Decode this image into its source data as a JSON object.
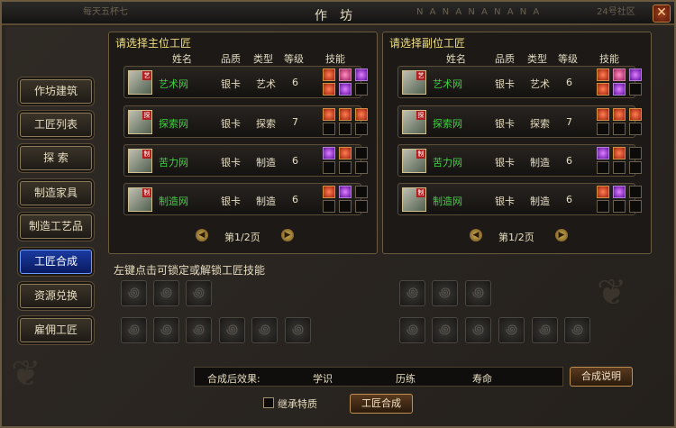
{
  "window": {
    "title": "作坊",
    "bg_left": "每天五杯七",
    "bg_right": "N A N A N A N A N A",
    "bg_far": "24号社区",
    "close_label": "✕"
  },
  "nav": [
    {
      "label": "作坊建筑",
      "active": false
    },
    {
      "label": "工匠列表",
      "active": false
    },
    {
      "label": "探 索",
      "active": false
    },
    {
      "label": "制造家具",
      "active": false
    },
    {
      "label": "制造工艺品",
      "active": false
    },
    {
      "label": "工匠合成",
      "active": true
    },
    {
      "label": "资源兑换",
      "active": false
    },
    {
      "label": "雇佣工匠",
      "active": false
    }
  ],
  "columns": {
    "name": "姓名",
    "quality": "品质",
    "type": "类型",
    "level": "等级",
    "skills": "技能"
  },
  "main_panel": {
    "title": "请选择主位工匠",
    "rows": [
      {
        "tag": "艺",
        "name": "艺术网",
        "quality": "银卡",
        "type": "艺术",
        "level": "6",
        "skills": [
          "red",
          "pink",
          "purple",
          "red",
          "purple",
          "empty"
        ]
      },
      {
        "tag": "探",
        "name": "探索网",
        "quality": "银卡",
        "type": "探索",
        "level": "7",
        "skills": [
          "red",
          "red",
          "red",
          "empty",
          "empty",
          "empty"
        ]
      },
      {
        "tag": "制",
        "name": "苦力网",
        "quality": "银卡",
        "type": "制造",
        "level": "6",
        "skills": [
          "purple",
          "red",
          "empty",
          "empty",
          "empty",
          "empty"
        ]
      },
      {
        "tag": "制",
        "name": "制造网",
        "quality": "银卡",
        "type": "制造",
        "level": "6",
        "skills": [
          "red",
          "purple",
          "empty",
          "empty",
          "empty",
          "empty"
        ]
      }
    ],
    "pager": "第1/2页"
  },
  "sub_panel": {
    "title": "请选择副位工匠",
    "rows": [
      {
        "tag": "艺",
        "name": "艺术网",
        "quality": "银卡",
        "type": "艺术",
        "level": "6",
        "skills": [
          "red",
          "pink",
          "purple",
          "red",
          "purple",
          "empty"
        ]
      },
      {
        "tag": "探",
        "name": "探索网",
        "quality": "银卡",
        "type": "探索",
        "level": "7",
        "skills": [
          "red",
          "red",
          "red",
          "empty",
          "empty",
          "empty"
        ]
      },
      {
        "tag": "制",
        "name": "苦力网",
        "quality": "银卡",
        "type": "制造",
        "level": "6",
        "skills": [
          "purple",
          "red",
          "empty",
          "empty",
          "empty",
          "empty"
        ]
      },
      {
        "tag": "制",
        "name": "制造网",
        "quality": "银卡",
        "type": "制造",
        "level": "6",
        "skills": [
          "red",
          "purple",
          "empty",
          "empty",
          "empty",
          "empty"
        ]
      }
    ],
    "pager": "第1/2页"
  },
  "lock_hint": "左键点击可锁定或解锁工匠技能",
  "effect": {
    "label": "合成后效果:",
    "stats": [
      "学识",
      "历练",
      "寿命"
    ]
  },
  "buttons": {
    "help": "合成说明",
    "inherit": "继承特质",
    "compose": "工匠合成"
  },
  "icons": {
    "slot": "swirl-icon",
    "prev": "arrow-left-icon",
    "next": "arrow-right-icon"
  }
}
